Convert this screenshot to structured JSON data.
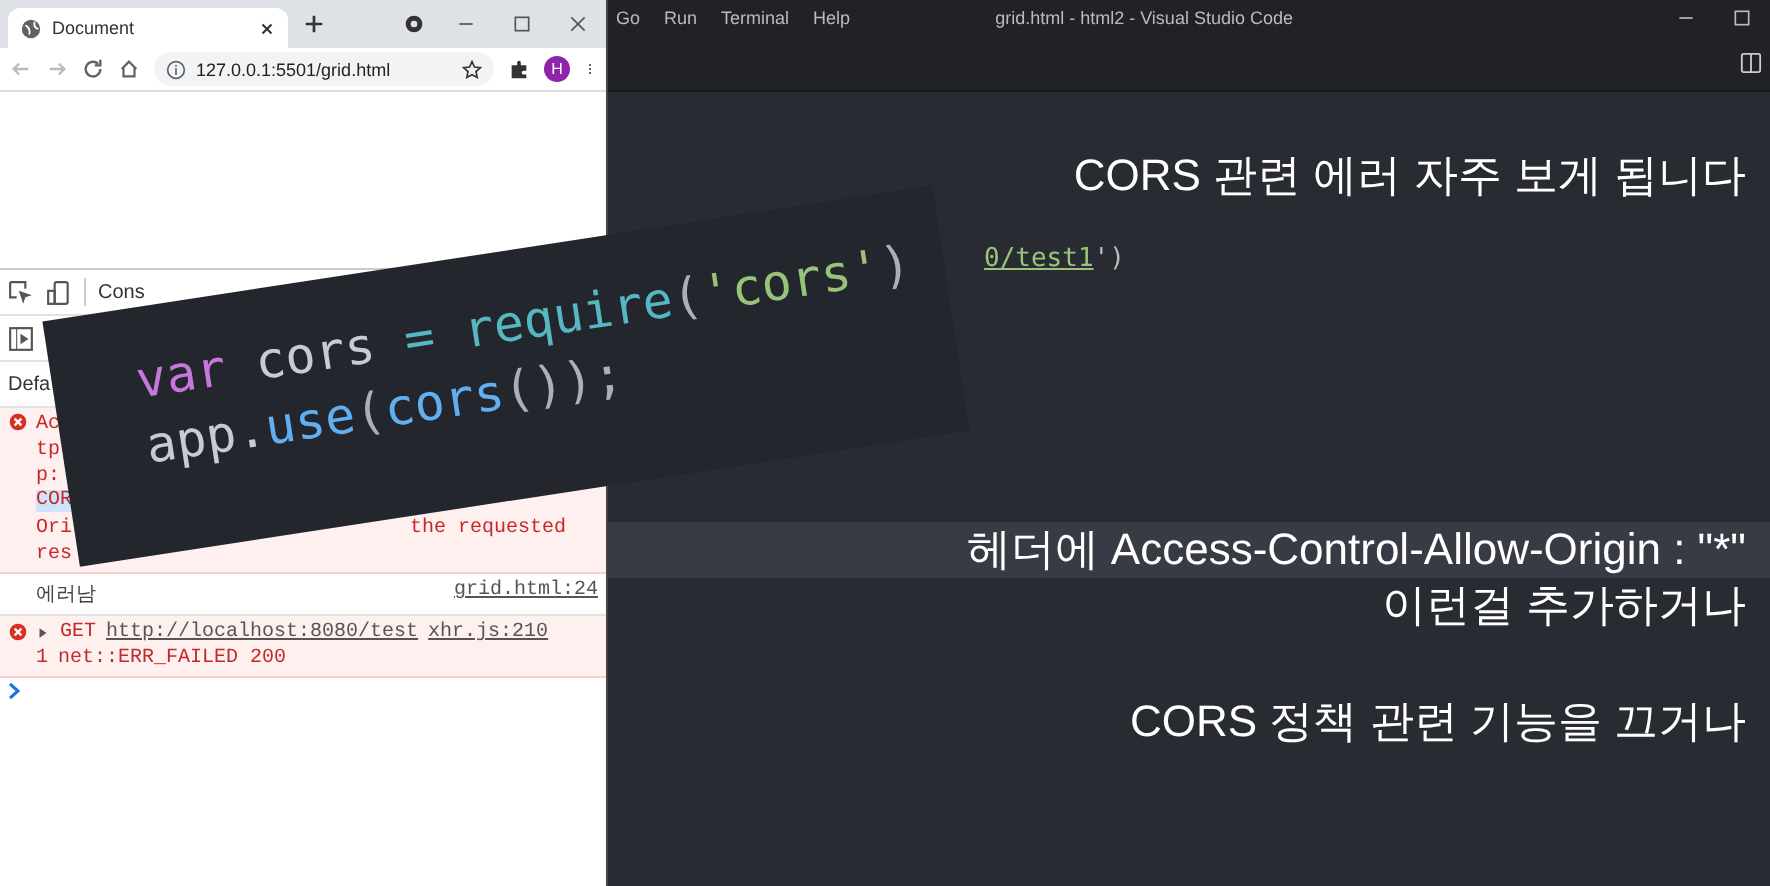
{
  "browser": {
    "tab_title": "Document",
    "url": "127.0.0.1:5501/grid.html",
    "avatar_letter": "H",
    "devtools": {
      "panel_tab": "Cons",
      "filter": "Defa",
      "messages": [
        {
          "kind": "error",
          "lines": [
            {
              "left": "Ac"
            },
            {
              "left": "tp"
            },
            {
              "left": "p:"
            },
            {
              "left": "COR"
            },
            {
              "left": "Ori",
              "right": "the requested"
            },
            {
              "left": "res"
            }
          ]
        },
        {
          "kind": "log",
          "text": "에러남",
          "source": "grid.html:24"
        },
        {
          "kind": "error_request",
          "method": "GET",
          "url": "http://localhost:8080/test",
          "source": "xhr.js:210",
          "count": "1",
          "detail": "net::ERR_FAILED 200"
        }
      ]
    }
  },
  "vscode": {
    "menu": [
      "Go",
      "Run",
      "Terminal",
      "Help"
    ],
    "title": "grid.html - html2 - Visual Studio Code",
    "code_fragment": {
      "link": "0/test1",
      "rest": "')"
    },
    "captions": [
      {
        "text": "CORS 관련 에러 자주 보게 됩니다",
        "highlighted": false
      },
      {
        "text": "헤더에 Access-Control-Allow-Origin : \"*\"",
        "highlighted": true
      },
      {
        "text": "이런걸 추가하거나",
        "highlighted": false
      },
      {
        "text": "CORS 정책 관련 기능을 끄거나",
        "highlighted": false
      }
    ]
  },
  "code_card": {
    "lines": [
      [
        {
          "kind": "keyword",
          "text": "var"
        },
        {
          "kind": "plain",
          "text": " cors "
        },
        {
          "kind": "operator",
          "text": "= "
        },
        {
          "kind": "function",
          "text": "require"
        },
        {
          "kind": "punct",
          "text": "("
        },
        {
          "kind": "string",
          "text": "'cors'"
        },
        {
          "kind": "punct",
          "text": ")"
        }
      ],
      [
        {
          "kind": "plain",
          "text": "app."
        },
        {
          "kind": "method",
          "text": "use"
        },
        {
          "kind": "punct",
          "text": "("
        },
        {
          "kind": "method",
          "text": "cors"
        },
        {
          "kind": "punct",
          "text": "());"
        }
      ]
    ]
  }
}
